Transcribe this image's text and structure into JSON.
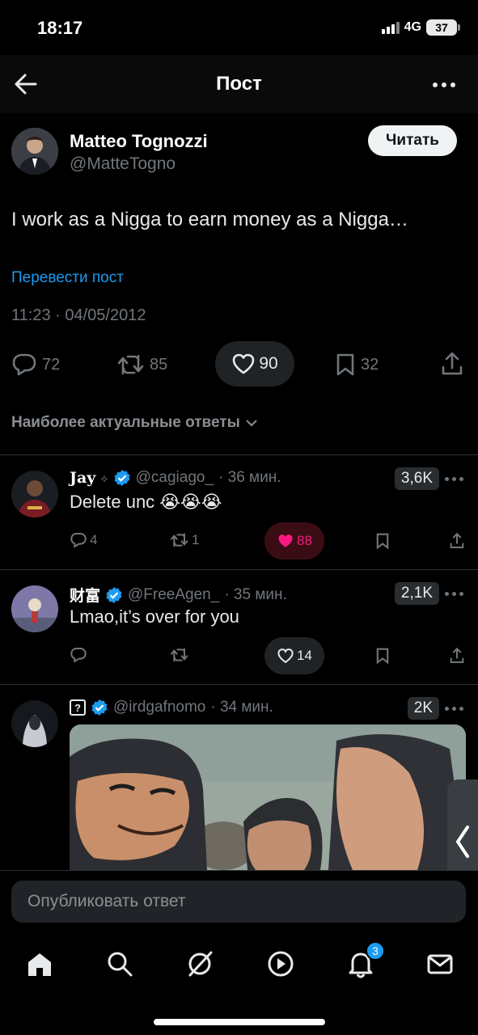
{
  "status": {
    "time": "18:17",
    "network": "4G",
    "battery": "37"
  },
  "nav": {
    "title": "Пост"
  },
  "post": {
    "author_name": "Matteo Tognozzi",
    "author_handle": "@MatteTogno",
    "follow_label": "Читать",
    "text": "I work as a Nigga to earn money as a Nigga…",
    "translate_label": "Перевести пост",
    "timestamp": "11:23 · 04/05/2012",
    "replies": "72",
    "reposts": "85",
    "likes": "90",
    "bookmarks": "32"
  },
  "sort_label": "Наиболее актуальные ответы",
  "replies": [
    {
      "name": "Jay",
      "handle": "@cagiago_",
      "time": "· 36 мин.",
      "badge": "3,6K",
      "text": "Delete unc 😭😭😭",
      "reply_count": "4",
      "repost_count": "1",
      "like_count": "88",
      "liked": true
    },
    {
      "name": "财富",
      "handle": "@FreeAgen_",
      "time": "· 35 мин.",
      "badge": "2,1K",
      "text": "Lmao,it’s over for you",
      "reply_count": "",
      "repost_count": "",
      "like_count": "14",
      "liked": false
    },
    {
      "name": "?",
      "handle": "@irdgafnomo",
      "time": "· 34 мин.",
      "badge": "2K",
      "text": ""
    }
  ],
  "composer": {
    "placeholder": "Опубликовать ответ"
  },
  "tabbar": {
    "notifications_count": "3"
  },
  "colors": {
    "accent": "#1d9bf0",
    "like": "#f91880",
    "background": "#000000"
  }
}
